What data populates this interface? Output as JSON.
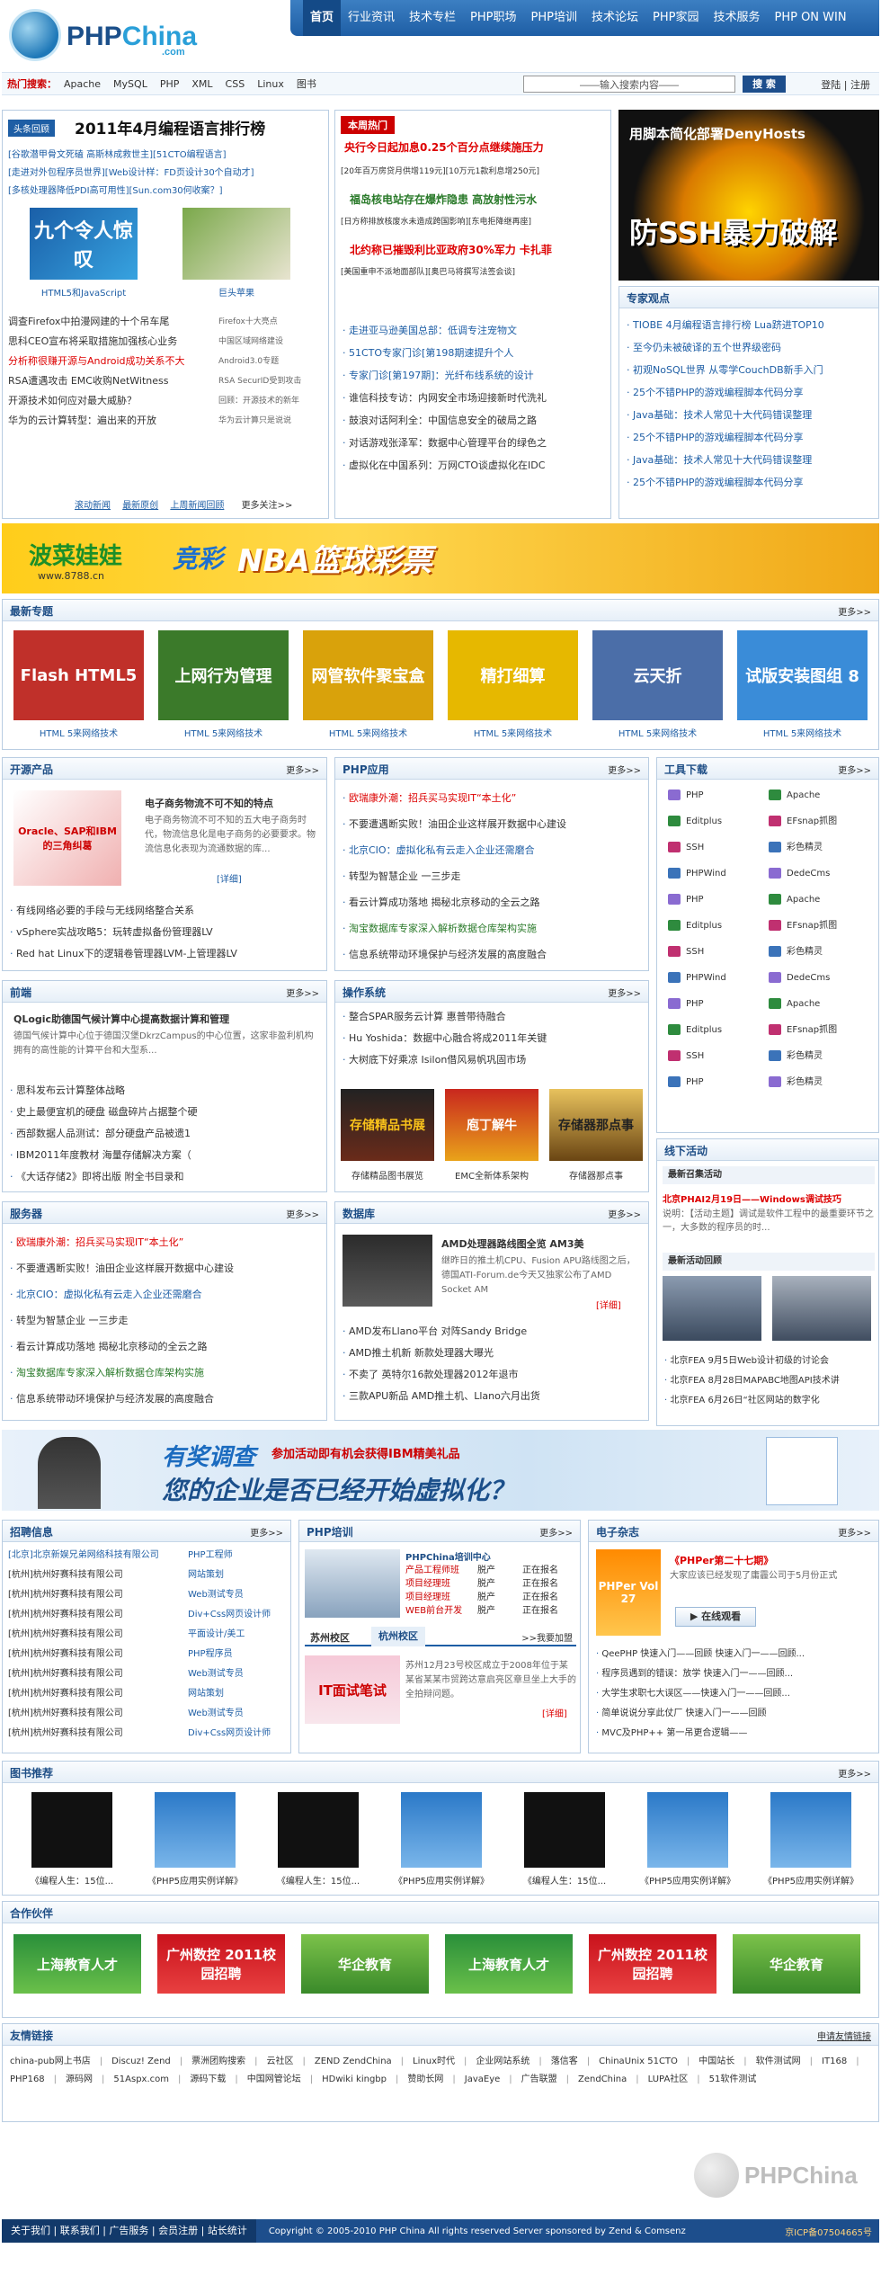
{
  "site": {
    "brand": "PHPChina",
    "brand_prefix": "PHP",
    "brand_suffix": "China",
    "domain": ".com"
  },
  "topnav": [
    "首页",
    "行业资讯",
    "技术专栏",
    "PHP职场",
    "PHP培训",
    "技术论坛",
    "PHP家园",
    "技术服务",
    "PHP ON WIN"
  ],
  "search": {
    "label": "热门搜索：",
    "keywords": [
      "Apache",
      "MySQL",
      "PHP",
      "XML",
      "CSS",
      "Linux",
      "图书"
    ],
    "placeholder": "——输入搜索内容——",
    "button": "搜 索",
    "login": "登陆",
    "sep": "|",
    "register": "注册"
  },
  "headlines": {
    "tag": "头条回顾",
    "title": "2011年4月编程语言排行榜",
    "items": [
      "[谷歌潜甲骨文死磕 高斯林成救世主][51CTO编程语言]",
      "[走进对外包程序员世界][Web设计样：FD页设计30个自动才]",
      "[多核处理器降低PDI高可用性][Sun.com30何收案？]"
    ],
    "pics": [
      "HTML5和JavaScript",
      "巨头苹果"
    ],
    "list": [
      "调查Firefox中拍漫网建的十个吊车尾",
      "思科CEO宣布将采取措施加强核心业务",
      "分析称很赚开源与Android成功关系不大",
      "RSA遭遇攻击 EMC收购NetWitness",
      "开源技术如何应对最大威胁？",
      "华为的云计算转型：遍出来的开放"
    ],
    "list_side": [
      "Firefox十大亮点",
      "中国区域网络建设",
      "Android3.0专题",
      "RSA SecurID受到攻击",
      "回顾：开源技术的新年",
      "华为云计算只是说说"
    ],
    "links": [
      "滚动新闻",
      "最新原创",
      "上周新闻回顾",
      "更多关注>>"
    ]
  },
  "weekly": {
    "tag": "本周热门",
    "title": "央行今日起加息0.25个百分点继续施压力",
    "sub1": "[20年百万房贷月供增119元][10万元1款利息增250元]",
    "title2": "福岛核电站存在爆炸隐患 高放射性污水",
    "sub2": "[日方称排放核废水未造成跨国影响][东电拒降继再座]",
    "title3": "北约称已摧毁利比亚政府30%军力 卡扎菲",
    "sub3": "[美国重申不派地面部队][奥巴马将撰写法签会谈]",
    "list": [
      "走进亚马逊美国总部：低调专注宠物文",
      "51CTO专家门诊[第198期速提升个人",
      "专家门诊[第197期]：光纤布线系统的设计",
      "谁信科技专访：内网安全市场迎接新时代洗礼",
      "鼓浪对话阿利全：中国信息安全的破局之路",
      "对话游戏张泽军：数据中心管理平台的绿色之",
      "虚拟化在中国系列：万网CTO谈虚拟化在IDC"
    ]
  },
  "ssh": {
    "line1": "用脚本简化部署DenyHosts",
    "line2": "防SSH暴力破解"
  },
  "expert": {
    "title": "专家观点",
    "items": [
      "TIOBE 4月编程语言排行榜 Lua跻进TOP10",
      "至今仍未被破译的五个世界级密码",
      "初观NoSQL世界 从零学CouchDB新手入门",
      "25个不错PHP的游戏编程脚本代码分享",
      "Java基础：技术人常见十大代码错误整理",
      "25个不错PHP的游戏编程脚本代码分享",
      "Java基础：技术人常见十大代码错误整理",
      "25个不错PHP的游戏编程脚本代码分享"
    ]
  },
  "nba": {
    "left": "波菜娃娃",
    "url": "www.8788.cn",
    "center": "竞彩",
    "right": "NBA篮球彩票"
  },
  "topics": {
    "title": "最新专题",
    "more": "更多>>",
    "items": [
      {
        "label": "HTML 5来网络技术",
        "pic": "Flash HTML5",
        "color": "#c0302a"
      },
      {
        "label": "HTML 5来网络技术",
        "pic": "上网行为管理",
        "color": "#3b7a2a"
      },
      {
        "label": "HTML 5来网络技术",
        "pic": "网管软件聚宝盒",
        "color": "#d9a20b"
      },
      {
        "label": "HTML 5来网络技术",
        "pic": "精打细算",
        "color": "#e6b800"
      },
      {
        "label": "HTML 5来网络技术",
        "pic": "云天折",
        "color": "#4b6ea8"
      },
      {
        "label": "HTML 5来网络技术",
        "pic": "试版安装图组 8",
        "color": "#3a8cd8"
      }
    ]
  },
  "oss": {
    "title": "开源产品",
    "more": "更多>>",
    "feature": "电子商务物流不可不知的特点",
    "desc": "电子商务物流不可不知的五大电子商务时代，物流信息化是电子商务的必要要求。物流信息化表现为流通数据的库...",
    "detail": "[详细]",
    "pic": "Oracle、SAP和IBM的三角纠葛",
    "items": [
      "有线网络必要的手段与无线网络整合关系",
      "vSphere实战攻略5：玩转虚拟备份管理器LV",
      "Red hat Linux下的逻辑卷管理器LVM-上管理器LV"
    ]
  },
  "phpapp": {
    "title": "PHP应用",
    "more": "更多>>",
    "items": [
      "欧瑞康外潮：招兵买马实现IT“本土化”",
      "不要遭遇断实败！油田企业这样展开数据中心建设",
      "北京CIO：虚拟化私有云走入企业还需磨合",
      "转型为智慧企业 一三步走",
      "看云计算成功落地 揭秘北京移动的全云之路",
      "淘宝数据库专家深入解析数据仓库架构实施",
      "信息系统带动环境保护与经济发展的高度融合"
    ]
  },
  "tools": {
    "title": "工具下载",
    "more": "更多>>",
    "rows": [
      [
        "PHP",
        "Apache"
      ],
      [
        "Editplus",
        "EFsnap抓图"
      ],
      [
        "SSH",
        "彩色精灵"
      ],
      [
        "PHPWind",
        "DedeCms"
      ],
      [
        "PHP",
        "Apache"
      ],
      [
        "Editplus",
        "EFsnap抓图"
      ],
      [
        "SSH",
        "彩色精灵"
      ],
      [
        "PHPWind",
        "DedeCms"
      ],
      [
        "PHP",
        "Apache"
      ],
      [
        "Editplus",
        "EFsnap抓图"
      ],
      [
        "SSH",
        "彩色精灵"
      ],
      [
        "PHP",
        "彩色精灵"
      ]
    ]
  },
  "frontend": {
    "title": "前端",
    "more": "更多>>",
    "feature": "QLogic助德国气候计算中心提高数据计算和管理",
    "desc": "德国气候计算中心位于德国汉堡DkrzCampus的中心位置，这家非盈利机构拥有的高性能的计算平台和大型系...",
    "items": [
      "思科发布云计算整体战略",
      "史上最便宜机的硬盘 磁盘碎片占据整个硬",
      "西部数据人品测试：部分硬盘产品被遗1",
      "IBM2011年度教材 海量存储解决方案（",
      "《大话存储2》即将出版 附全书目录和"
    ]
  },
  "ops": {
    "title": "操作系统",
    "more": "更多>>",
    "items": [
      "整合SPAR服务云计算 惠普带待融合",
      "Hu Yoshida：数据中心融合将成2011年关键",
      "大树底下好乘凉 Isilon借风易帆巩固市场"
    ],
    "pics": [
      {
        "pic": "存储精品书展",
        "label": "存储精品图书展览"
      },
      {
        "pic": "庖丁解牛",
        "label": "EMC全新体系架构"
      },
      {
        "pic": "存储器那点事",
        "label": "存储器那点事"
      }
    ]
  },
  "online": {
    "title": "线下活动",
    "sub": "最新召集活动",
    "feature": "北京PHAI2月19日——Windows调试技巧",
    "desc": "说明：【活动主题】调试是软件工程中的最重要环节之一，大多数的程序员的时...",
    "sub2": "最新活动回顾",
    "items": [
      "北京FEA 9月5日Web设计初级的讨论会",
      "北京FEA 8月28日MAPABC地图API技术讲",
      "北京FEA 6月26日“社区网站的数字化"
    ]
  },
  "service": {
    "title": "服务器",
    "more": "更多>>",
    "items": [
      "欧瑞康外潮：招兵买马实现IT“本土化”",
      "不要遭遇断实败！油田企业这样展开数据中心建设",
      "北京CIO：虚拟化私有云走入企业还需磨合",
      "转型为智慧企业 一三步走",
      "看云计算成功落地 揭秘北京移动的全云之路",
      "淘宝数据库专家深入解析数据仓库架构实施",
      "信息系统带动环境保护与经济发展的高度融合"
    ]
  },
  "db": {
    "title": "数据库",
    "more": "更多>>",
    "feature": "AMD处理器路线图全览 AM3美",
    "desc": "继昨日的推土机CPU、Fusion APU路线图之后，德国ATI-Forum.de今天又独家公布了AMD Socket AM",
    "detail": "[详细]",
    "items": [
      "AMD发布Llano平台 对阵Sandy Bridge",
      "AMD推土机新 新款处理器大曝光",
      "不卖了 英特尔16款处理器2012年退市",
      "三款APU新品 AMD推土机、Llano六月出货"
    ]
  },
  "ibm": {
    "a": "有奖调查",
    "b": "参加活动即有机会获得IBM精美礼品",
    "c": "您的企业是否已经开始虚拟化？"
  },
  "jobs": {
    "title": "招聘信息",
    "more": "更多>>",
    "rows": [
      [
        "[北京]北京新娱兄弟网络科技有限公司",
        "PHP工程师"
      ],
      [
        "[杭州]杭州好赛科技有限公司",
        "网站策划"
      ],
      [
        "[杭州]杭州好赛科技有限公司",
        "Web测试专员"
      ],
      [
        "[杭州]杭州好赛科技有限公司",
        "Div+Css网页设计师"
      ],
      [
        "[杭州]杭州好赛科技有限公司",
        "平面设计/美工"
      ],
      [
        "[杭州]杭州好赛科技有限公司",
        "PHP程序员"
      ],
      [
        "[杭州]杭州好赛科技有限公司",
        "Web测试专员"
      ],
      [
        "[杭州]杭州好赛科技有限公司",
        "网站策划"
      ],
      [
        "[杭州]杭州好赛科技有限公司",
        "Web测试专员"
      ],
      [
        "[杭州]杭州好赛科技有限公司",
        "Div+Css网页设计师"
      ]
    ]
  },
  "training": {
    "title": "PHP培训",
    "more": "更多>>",
    "brand": "PHPChina培训中心",
    "rows": [
      [
        "产品工程师班",
        "脱产",
        "正在报名"
      ],
      [
        "项目经理班",
        "脱产",
        "正在报名"
      ],
      [
        "项目经理班",
        "脱产",
        "正在报名"
      ],
      [
        "WEB前台开发",
        "脱产",
        "正在报名"
      ]
    ],
    "tab1": "苏州校区",
    "tab2": "杭州校区",
    "tab_more": ">>我要加盟",
    "pic": "IT面试笔试",
    "desc": "苏州12月23号校区成立于2008年位于某某省某某市贸跨达意启亮区章旦坐上大手的全拍辩问题。",
    "detail": "[详细]"
  },
  "emag": {
    "title": "电子杂志",
    "more": "更多>>",
    "issue": "《PHPer第二十七期》",
    "desc": "大家应该已经发现了庸霾公司于5月份正式",
    "cover": "PHPer Vol 27",
    "btn": "在线观看",
    "items": [
      "QeePHP 快速入门——回顾 快速入门一——回顾...",
      "程序员遇到的错误：放学 快速入门一——回顾...",
      "大学生求职七大误区——快速入门一——回顾...",
      "简单说说分享此仗厂 快速入门一——回顾",
      "MVC及PHP++ 第一吊更合逻辑——"
    ]
  },
  "books": {
    "title": "图书推荐",
    "more": "更多>>",
    "items": [
      "《编程人生：15位...",
      "《PHP5应用实例详解》",
      "《编程人生：15位...",
      "《PHP5应用实例详解》",
      "《编程人生：15位...",
      "《PHP5应用实例详解》",
      "《PHP5应用实例详解》"
    ]
  },
  "partners": {
    "title": "合作伙伴",
    "items": [
      "上海教育人才",
      "广州数控 2011校园招聘",
      "华企教育",
      "上海教育人才",
      "广州数控 2011校园招聘",
      "华企教育"
    ]
  },
  "friends": {
    "title": "友情链接",
    "apply": "申请友情链接",
    "links": [
      "china-pub网上书店",
      "Discuz! Zend",
      "票洲团购搜索",
      "云社区",
      "ZEND ZendChina",
      "Linux时代",
      "企业网站系统",
      "落信客",
      "ChinaUnix 51CTO",
      "中国站长",
      "软件测试网",
      "IT168",
      "PHP168",
      "源码网",
      "51Aspx.com",
      "源码下载",
      "中国网管论坛",
      "HDwiki kingbp",
      "赞助长网",
      "JavaEye",
      "广告联盟",
      "ZendChina",
      "LUPA社区",
      "51软件测试"
    ]
  },
  "footer": {
    "links": [
      "关于我们",
      "联系我们",
      "广告服务",
      "会员注册",
      "站长统计"
    ],
    "copy": "Copyright © 2005-2010 PHP China All rights reserved Server sponsored by Zend & Comsenz",
    "icp": "京ICP备07504665号"
  },
  "colors": {
    "nav": "#1e5ea5",
    "accent_red": "#dd0000",
    "link_blue": "#1e5ea5"
  }
}
